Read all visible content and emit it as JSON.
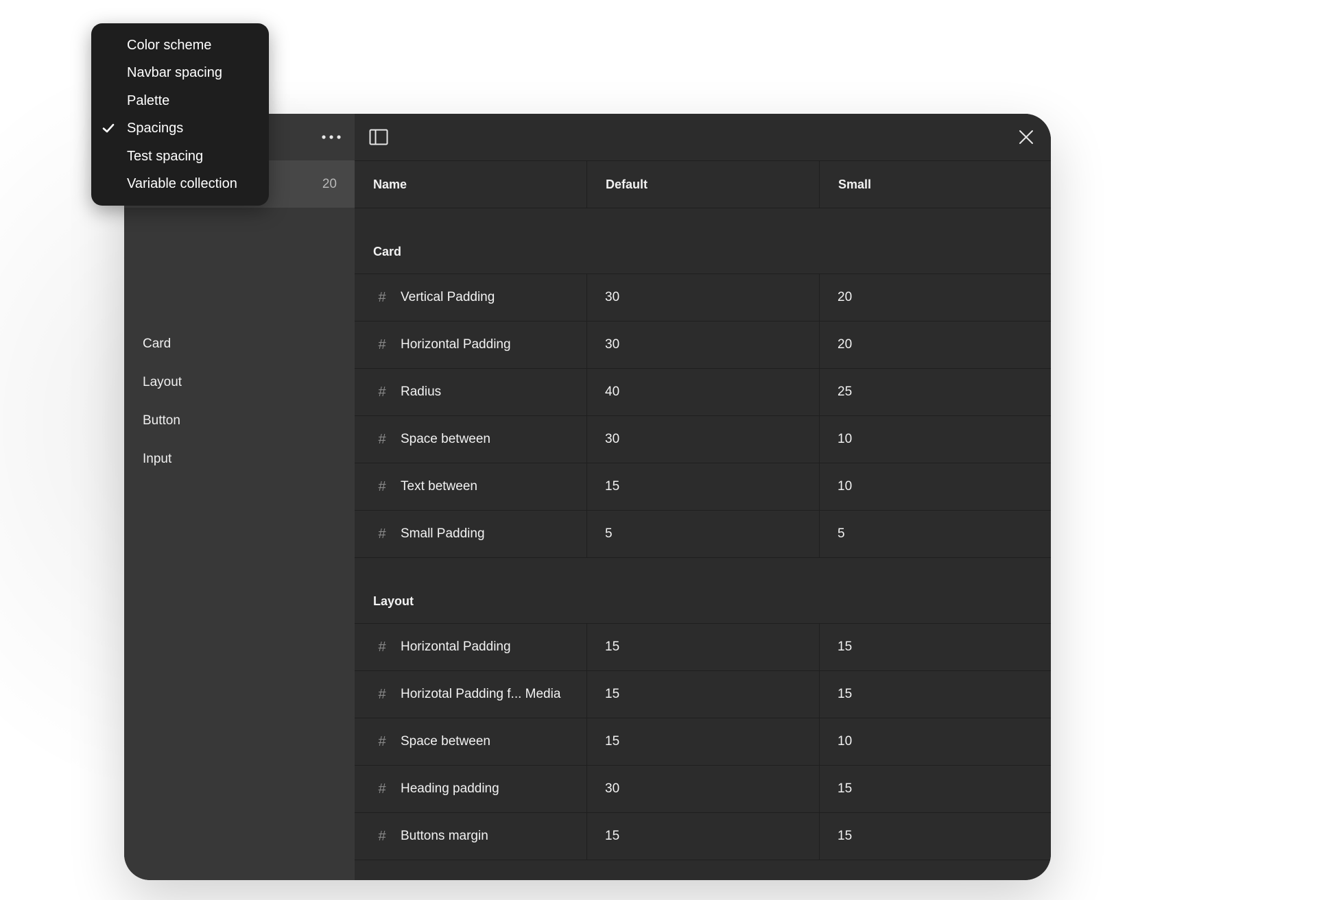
{
  "sidebar": {
    "selected_count": "20",
    "items": [
      {
        "label": "Card"
      },
      {
        "label": "Layout"
      },
      {
        "label": "Button"
      },
      {
        "label": "Input"
      }
    ]
  },
  "dropdown": {
    "items": [
      {
        "label": "Color scheme",
        "checked": false
      },
      {
        "label": "Navbar spacing",
        "checked": false
      },
      {
        "label": "Palette",
        "checked": false
      },
      {
        "label": "Spacings",
        "checked": true
      },
      {
        "label": "Test spacing",
        "checked": false
      },
      {
        "label": "Variable collection",
        "checked": false
      }
    ]
  },
  "table": {
    "columns": {
      "name": "Name",
      "default": "Default",
      "small": "Small"
    },
    "groups": [
      {
        "label": "Card",
        "rows": [
          {
            "name": "Vertical Padding",
            "default": "30",
            "small": "20"
          },
          {
            "name": "Horizontal Padding",
            "default": "30",
            "small": "20"
          },
          {
            "name": "Radius",
            "default": "40",
            "small": "25"
          },
          {
            "name": "Space between",
            "default": "30",
            "small": "10"
          },
          {
            "name": "Text between",
            "default": "15",
            "small": "10"
          },
          {
            "name": "Small Padding",
            "default": "5",
            "small": "5"
          }
        ]
      },
      {
        "label": "Layout",
        "rows": [
          {
            "name": "Horizontal Padding",
            "default": "15",
            "small": "15"
          },
          {
            "name": "Horizotal Padding f... Media",
            "default": "15",
            "small": "15"
          },
          {
            "name": "Space between",
            "default": "15",
            "small": "10"
          },
          {
            "name": "Heading padding",
            "default": "30",
            "small": "15"
          },
          {
            "name": "Buttons margin",
            "default": "15",
            "small": "15"
          }
        ]
      }
    ]
  },
  "colors": {
    "panel": "#2c2c2c",
    "sidebar": "#383838",
    "sidebar_selected": "#474747",
    "dropdown": "#1e1e1e",
    "hash_icon": "#8a8a8a"
  },
  "icons": {
    "more": "more-horizontal-icon",
    "sidebar_toggle": "sidebar-toggle-icon",
    "close": "close-icon",
    "variable": "hash-icon",
    "check": "checkmark-icon"
  }
}
